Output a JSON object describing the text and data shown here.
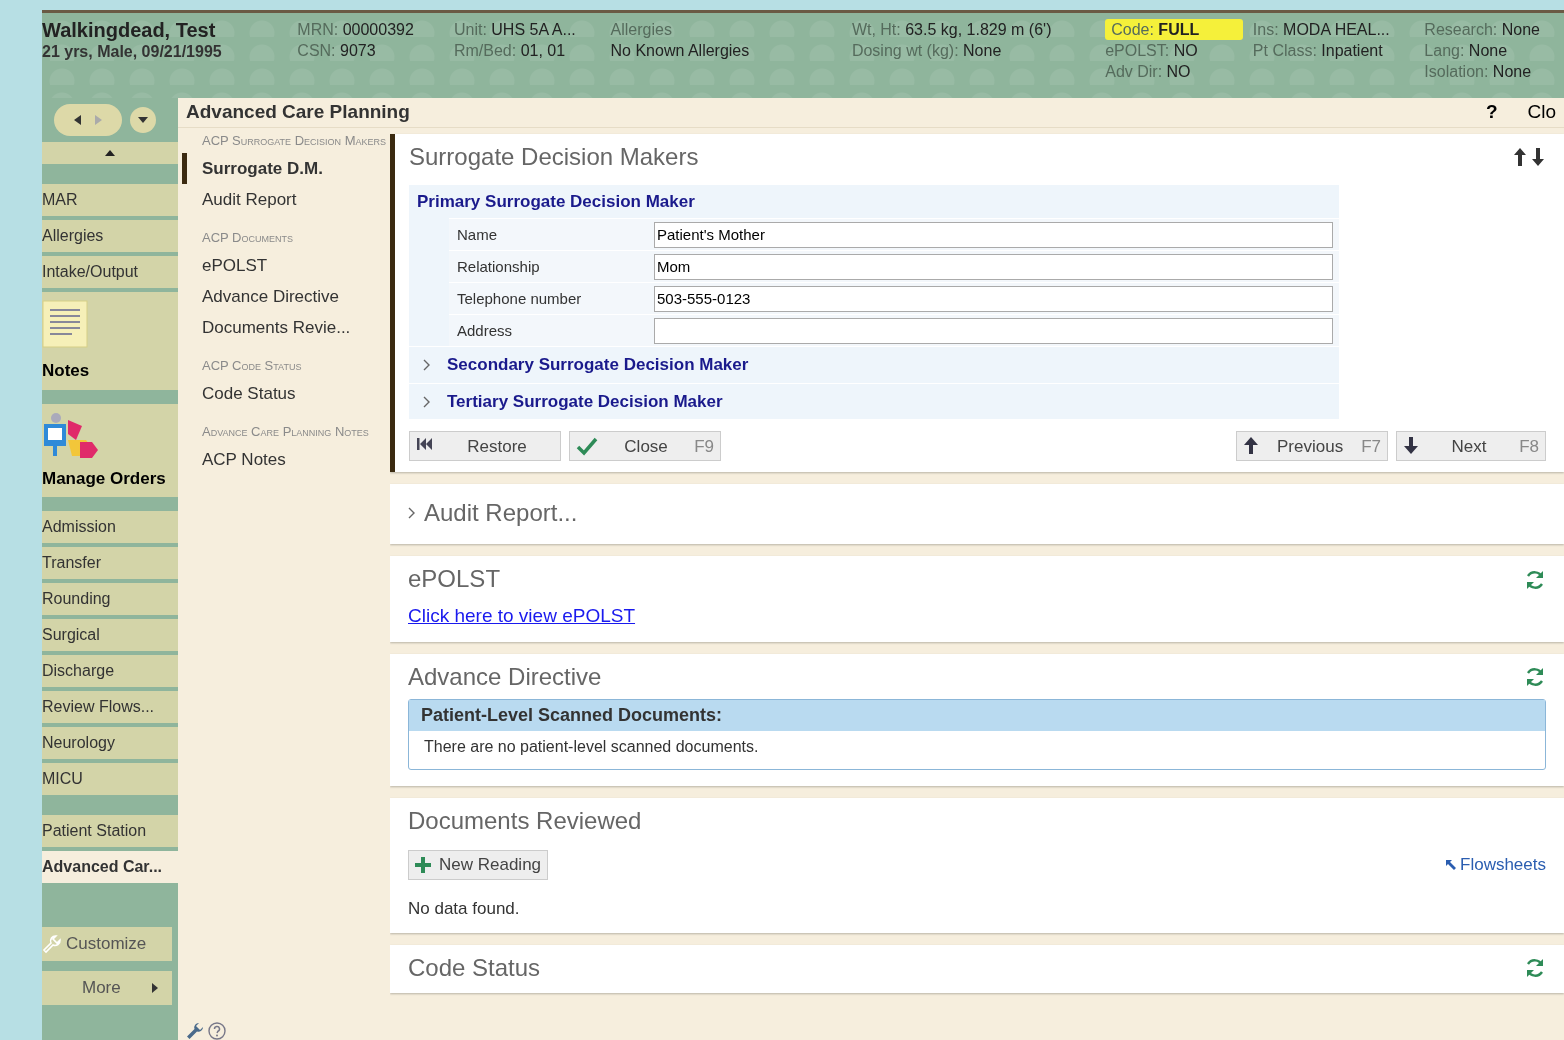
{
  "patient_header": {
    "name": "Walkingdead, Test",
    "demographics": "21 yrs, Male, 09/21/1995",
    "columns": [
      {
        "lines": [
          {
            "label": "MRN:",
            "value": "00000392"
          },
          {
            "label": "CSN:",
            "value": "9073"
          }
        ]
      },
      {
        "lines": [
          {
            "label": "Unit:",
            "value": "UHS 5A A..."
          },
          {
            "label": "Rm/Bed:",
            "value": "01, 01"
          }
        ]
      },
      {
        "lines": [
          {
            "label": "Allergies"
          },
          {
            "value": "No Known Allergies"
          }
        ]
      },
      {
        "lines": [
          {
            "label": "Wt, Ht:",
            "value": "63.5 kg, 1.829 m (6')"
          },
          {
            "label": "Dosing wt (kg):",
            "value": "None"
          }
        ]
      },
      {
        "lines": [
          {
            "label": "Code:",
            "value": "FULL",
            "highlighted": true
          },
          {
            "label": "ePOLST:",
            "value": "NO"
          },
          {
            "label": "Adv Dir:",
            "value": "NO"
          }
        ]
      },
      {
        "lines": [
          {
            "label": "Ins:",
            "value": "MODA HEAL..."
          },
          {
            "label": "Pt Class:",
            "value": "Inpatient"
          }
        ]
      },
      {
        "lines": [
          {
            "label": "Research:",
            "value": "None"
          },
          {
            "label": "Lang:",
            "value": "None"
          },
          {
            "label": "Isolation:",
            "value": "None"
          }
        ]
      }
    ]
  },
  "activity_title": "Advanced Care Planning",
  "title_bar_actions": [
    "?",
    "Clo"
  ],
  "sidebar": {
    "sections": [
      {
        "items": [
          {
            "label": "MAR",
            "kind": "plain",
            "selected": false
          },
          {
            "label": "Allergies",
            "kind": "plain",
            "selected": false
          },
          {
            "label": "Intake/Output",
            "kind": "plain",
            "selected": false
          },
          {
            "label": "Notes",
            "kind": "notes",
            "selected": false
          },
          {
            "label": "Manage Orders",
            "kind": "orders",
            "selected": false
          },
          {
            "label": "Admission",
            "kind": "plain",
            "selected": false
          },
          {
            "label": "Transfer",
            "kind": "plain",
            "selected": false
          },
          {
            "label": "Rounding",
            "kind": "plain",
            "selected": false
          },
          {
            "label": "Surgical",
            "kind": "plain",
            "selected": false
          },
          {
            "label": "Discharge",
            "kind": "plain",
            "selected": false
          },
          {
            "label": "Review Flows...",
            "kind": "plain",
            "selected": false
          },
          {
            "label": "Neurology",
            "kind": "plain",
            "selected": false
          },
          {
            "label": "MICU",
            "kind": "plain",
            "selected": false
          }
        ]
      },
      {
        "items": [
          {
            "label": "Patient Station",
            "kind": "plain",
            "selected": false
          },
          {
            "label": "Advanced Car...",
            "kind": "plain",
            "selected": true
          }
        ]
      }
    ],
    "customize": "Customize",
    "more": "More"
  },
  "section_nav": [
    {
      "heading": "ACP Surrogate Decision Makers",
      "items": [
        {
          "label": "Surrogate D.M.",
          "selected": true
        },
        {
          "label": "Audit Report",
          "selected": false
        }
      ]
    },
    {
      "heading": "ACP Documents",
      "items": [
        {
          "label": "ePOLST",
          "selected": false
        },
        {
          "label": "Advance Directive",
          "selected": false
        },
        {
          "label": "Documents Revie...",
          "selected": false
        }
      ]
    },
    {
      "heading": "ACP Code Status",
      "items": [
        {
          "label": "Code Status",
          "selected": false
        }
      ]
    },
    {
      "heading": "Advance Care Planning Notes",
      "items": [
        {
          "label": "ACP Notes",
          "selected": false
        }
      ]
    }
  ],
  "cards": [
    {
      "kind": "surrogate",
      "title": "Surrogate Decision Makers",
      "groups": [
        {
          "title": "Primary Surrogate Decision Maker",
          "expanded": true,
          "fields": [
            {
              "label": "Name",
              "value": "Patient's Mother"
            },
            {
              "label": "Relationship",
              "value": "Mom"
            },
            {
              "label": "Telephone number",
              "value": "503-555-0123"
            },
            {
              "label": "Address"
            }
          ]
        },
        {
          "title": "Secondary Surrogate Decision Maker",
          "expanded": false
        },
        {
          "title": "Tertiary Surrogate Decision Maker",
          "expanded": false
        }
      ],
      "buttons": [
        {
          "kind": "restore",
          "label": "Restore"
        },
        {
          "kind": "close",
          "label": "Close",
          "key": "F9"
        },
        {
          "kind": "previous",
          "label": "Previous",
          "key": "F7"
        },
        {
          "kind": "next",
          "label": "Next",
          "key": "F8"
        }
      ]
    },
    {
      "kind": "collapsed",
      "title": "Audit Report..."
    },
    {
      "kind": "link",
      "title": "ePOLST",
      "link": "Click here to view ePOLST"
    },
    {
      "kind": "documents",
      "title": "Advance Directive",
      "table_title": "Patient-Level Scanned Documents:",
      "message": "There are no patient-level scanned documents."
    },
    {
      "kind": "readings",
      "title": "Documents Reviewed",
      "button": "New Reading",
      "link": "Flowsheets",
      "message": "No data found."
    },
    {
      "kind": "plain",
      "title": "Code Status"
    }
  ]
}
